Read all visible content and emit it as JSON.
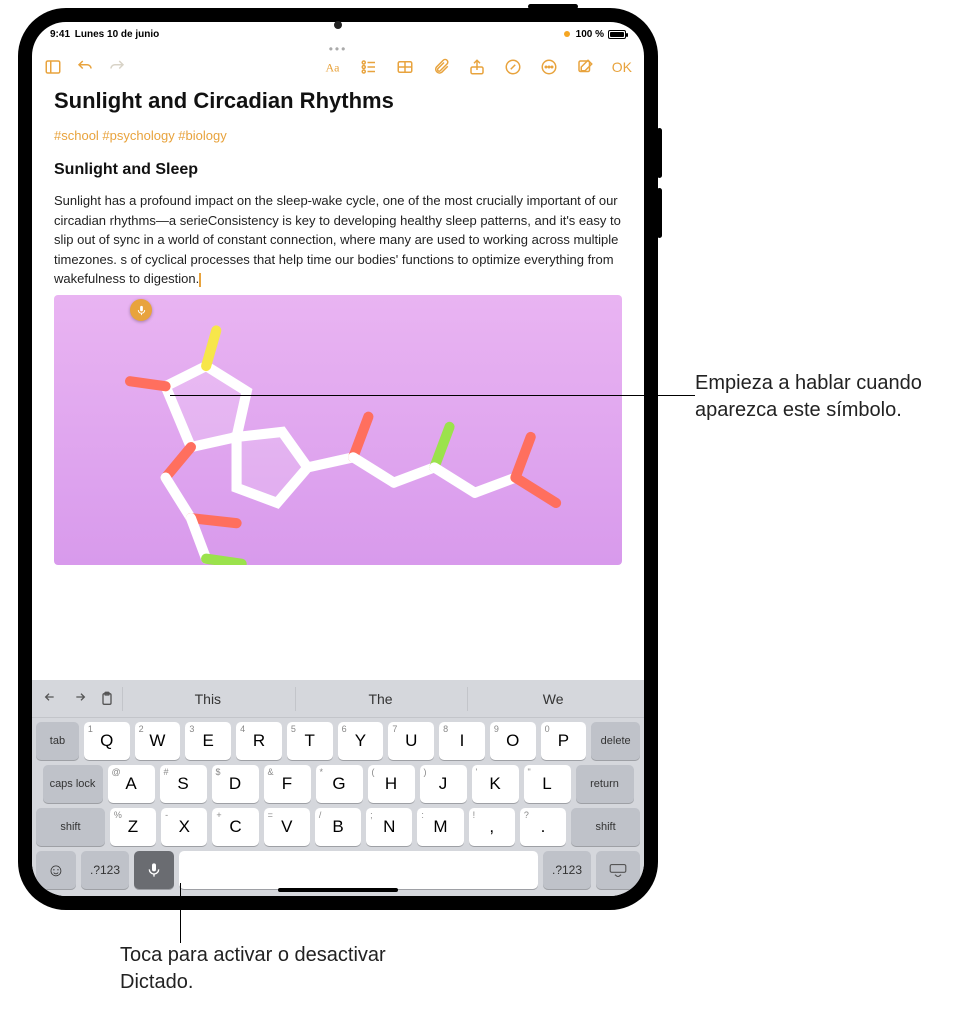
{
  "status": {
    "time": "9:41",
    "date": "Lunes 10 de junio",
    "battery_pct": "100 %"
  },
  "toolbar": {
    "ok": "OK"
  },
  "note": {
    "title": "Sunlight and Circadian Rhythms",
    "tags": "#school #psychology #biology",
    "subtitle": "Sunlight and Sleep",
    "body": "Sunlight has a profound impact on the sleep-wake cycle, one of the most crucially important of our circadian rhythms—a serieConsistency is key to developing healthy sleep patterns, and it's easy to slip out of sync in a world of constant connection, where many are used to working across multiple timezones. s of cyclical processes that help time our bodies' functions to optimize everything from wakefulness to digestion."
  },
  "suggestions": [
    "This",
    "The",
    "We"
  ],
  "keys": {
    "row1_alt": [
      "1",
      "2",
      "3",
      "4",
      "5",
      "6",
      "7",
      "8",
      "9",
      "0"
    ],
    "row1": [
      "Q",
      "W",
      "E",
      "R",
      "T",
      "Y",
      "U",
      "I",
      "O",
      "P"
    ],
    "row2_alt": [
      "@",
      "#",
      "$",
      "&",
      "*",
      "(",
      ")",
      "'",
      "\""
    ],
    "row2": [
      "A",
      "S",
      "D",
      "F",
      "G",
      "H",
      "J",
      "K",
      "L"
    ],
    "row3_alt": [
      "%",
      "-",
      "+",
      "=",
      "/",
      ";",
      ":",
      "!",
      "?"
    ],
    "row3": [
      "Z",
      "X",
      "C",
      "V",
      "B",
      "N",
      "M",
      ",",
      "."
    ],
    "tab": "tab",
    "delete": "delete",
    "caps": "caps lock",
    "return": "return",
    "shift": "shift",
    "num": ".?123"
  },
  "callouts": {
    "speak": "Empieza a hablar cuando aparezca este símbolo.",
    "dictate": "Toca para activar o desactivar Dictado."
  }
}
